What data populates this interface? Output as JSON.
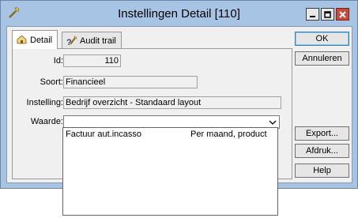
{
  "window": {
    "title": "Instellingen Detail [110]"
  },
  "tabs": [
    {
      "label": "Detail",
      "icon": "detail-icon",
      "selected": true
    },
    {
      "label": "Audit trail",
      "icon": "audit-icon",
      "selected": false
    }
  ],
  "form": {
    "id_label": "Id:",
    "id_value": "110",
    "soort_label": "Soort:",
    "soort_value": "Financieel",
    "instelling_label": "Instelling:",
    "instelling_value": "Bedrijf overzicht - Standaard layout",
    "waarde_label": "Waarde:",
    "waarde_value": ""
  },
  "buttons": {
    "ok": "OK",
    "annuleren": "Annuleren",
    "export": "Export...",
    "afdruk": "Afdruk...",
    "help": "Help"
  },
  "dropdown": {
    "options": [
      {
        "col1": "Factuur aut.incasso",
        "col2": "Per maand, product"
      }
    ]
  },
  "colors": {
    "titlebar": "#a8c4e4",
    "close": "#c94a3a"
  }
}
